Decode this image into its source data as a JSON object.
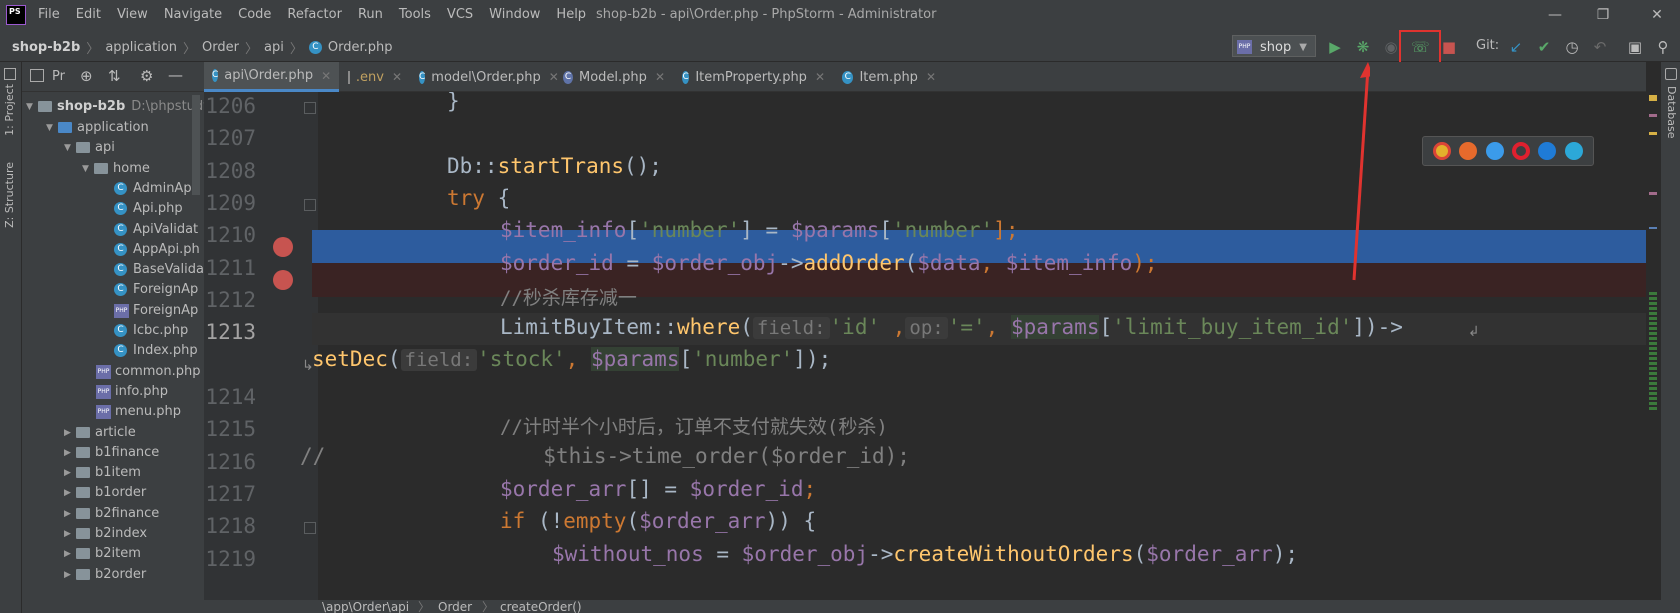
{
  "titlebar": {
    "menu": [
      "File",
      "Edit",
      "View",
      "Navigate",
      "Code",
      "Refactor",
      "Run",
      "Tools",
      "VCS",
      "Window",
      "Help"
    ],
    "title": "shop-b2b - api\\Order.php - PhpStorm - Administrator",
    "logo": "PS"
  },
  "navbar": {
    "breadcrumb": [
      "shop-b2b",
      "application",
      "Order",
      "api",
      "Order.php"
    ],
    "run_config": "shop",
    "git_label": "Git:"
  },
  "left_strip": {
    "project_label": "1: Project",
    "structure_label": "Z: Structure"
  },
  "right_strip": {
    "database_label": "Database"
  },
  "project": {
    "panel_label": "Pr",
    "root": {
      "name": "shop-b2b",
      "path": "D:\\phpstudy"
    },
    "items": [
      {
        "label": "application",
        "depth": 1,
        "kind": "folder-blue",
        "arrow": "▼"
      },
      {
        "label": "api",
        "depth": 2,
        "kind": "folder",
        "arrow": "▼"
      },
      {
        "label": "home",
        "depth": 3,
        "kind": "folder",
        "arrow": "▼"
      },
      {
        "label": "AdminApi",
        "depth": 4,
        "kind": "class"
      },
      {
        "label": "Api.php",
        "depth": 4,
        "kind": "class"
      },
      {
        "label": "ApiValidat",
        "depth": 4,
        "kind": "class"
      },
      {
        "label": "AppApi.ph",
        "depth": 4,
        "kind": "class"
      },
      {
        "label": "BaseValida",
        "depth": 4,
        "kind": "class"
      },
      {
        "label": "ForeignAp",
        "depth": 4,
        "kind": "class"
      },
      {
        "label": "ForeignAp",
        "depth": 4,
        "kind": "php"
      },
      {
        "label": "Icbc.php",
        "depth": 4,
        "kind": "class"
      },
      {
        "label": "Index.php",
        "depth": 4,
        "kind": "class"
      },
      {
        "label": "common.php",
        "depth": 3,
        "kind": "php"
      },
      {
        "label": "info.php",
        "depth": 3,
        "kind": "php"
      },
      {
        "label": "menu.php",
        "depth": 3,
        "kind": "php"
      },
      {
        "label": "article",
        "depth": 2,
        "kind": "folder",
        "arrow": "▶"
      },
      {
        "label": "b1finance",
        "depth": 2,
        "kind": "folder",
        "arrow": "▶"
      },
      {
        "label": "b1item",
        "depth": 2,
        "kind": "folder",
        "arrow": "▶"
      },
      {
        "label": "b1order",
        "depth": 2,
        "kind": "folder",
        "arrow": "▶"
      },
      {
        "label": "b2finance",
        "depth": 2,
        "kind": "folder",
        "arrow": "▶"
      },
      {
        "label": "b2index",
        "depth": 2,
        "kind": "folder",
        "arrow": "▶"
      },
      {
        "label": "b2item",
        "depth": 2,
        "kind": "folder",
        "arrow": "▶"
      },
      {
        "label": "b2order",
        "depth": 2,
        "kind": "folder",
        "arrow": "▶"
      }
    ]
  },
  "tabs": [
    {
      "label": "api\\Order.php",
      "icon": "C",
      "active": true
    },
    {
      "label": ".env",
      "icon": "file"
    },
    {
      "label": "model\\Order.php",
      "icon": "C"
    },
    {
      "label": "Model.php",
      "icon": "M"
    },
    {
      "label": "ItemProperty.php",
      "icon": "C"
    },
    {
      "label": "Item.php",
      "icon": "C"
    }
  ],
  "editor": {
    "line_numbers": [
      "1206",
      "1207",
      "1208",
      "1209",
      "1210",
      "1211",
      "1212",
      "1213",
      "",
      "1214",
      "1215",
      "1216",
      "1217",
      "1218",
      "1219"
    ],
    "hint_field": "field:",
    "hint_op": "op:",
    "text": {
      "l1206": "}",
      "db": "Db::",
      "startTrans": "startTrans",
      "parens_semi": "();",
      "try": "try",
      "brace_open": " {",
      "item_info_var": "$item_info",
      "br_open": "[",
      "number_str": "'number'",
      "br_close": "]",
      "assign": " = ",
      "params_var": "$params",
      "br_close_semi": "];",
      "order_id_var": "$order_id",
      "order_obj_var": "$order_obj",
      "arrow": "->",
      "addOrder": "addOrder",
      "paren_open": "(",
      "data_var": "$data",
      "comma": ", ",
      "paren_close_semi": ");",
      "comment_seckill": "//秒杀库存减一",
      "limitbuy": "LimitBuyItem::",
      "where": "where",
      "id_str": "'id'",
      "comma_space": " ,",
      "eq_str": "'='",
      "limit_key": "'limit_buy_item_id'",
      "close_arrow": "])->",
      "setDec": "setDec",
      "stock_str": "'stock'",
      "close_all": "]);",
      "comment_timer": "//计时半个小时后，订单不支付就失效(秒杀)",
      "l1216_prefix": "//",
      "l1216_code": "$this->time_order($order_id);",
      "order_arr_var": "$order_arr",
      "empty_brackets": "[]",
      "semi": ";",
      "if": "if",
      "not_paren": " (!",
      "empty": "empty",
      "close_brace": ")) {",
      "without_nos": "$without_nos",
      "createWithout": "createWithoutOrders",
      "partial_end": ");"
    }
  },
  "status": {
    "breadcrumb": [
      "\\app\\Order\\api",
      "Order",
      "createOrder()"
    ]
  },
  "colors": {
    "selected_line": "#2d5c9e",
    "breakpoint_line": "#3a2323",
    "breakpoint": "#c75450",
    "annotation_red": "#e0332f"
  },
  "icons": {
    "run": "run-icon",
    "debug": "debug-icon",
    "coverage": "coverage-icon",
    "listen": "listen-debug-connections-icon",
    "stop": "stop-icon"
  }
}
